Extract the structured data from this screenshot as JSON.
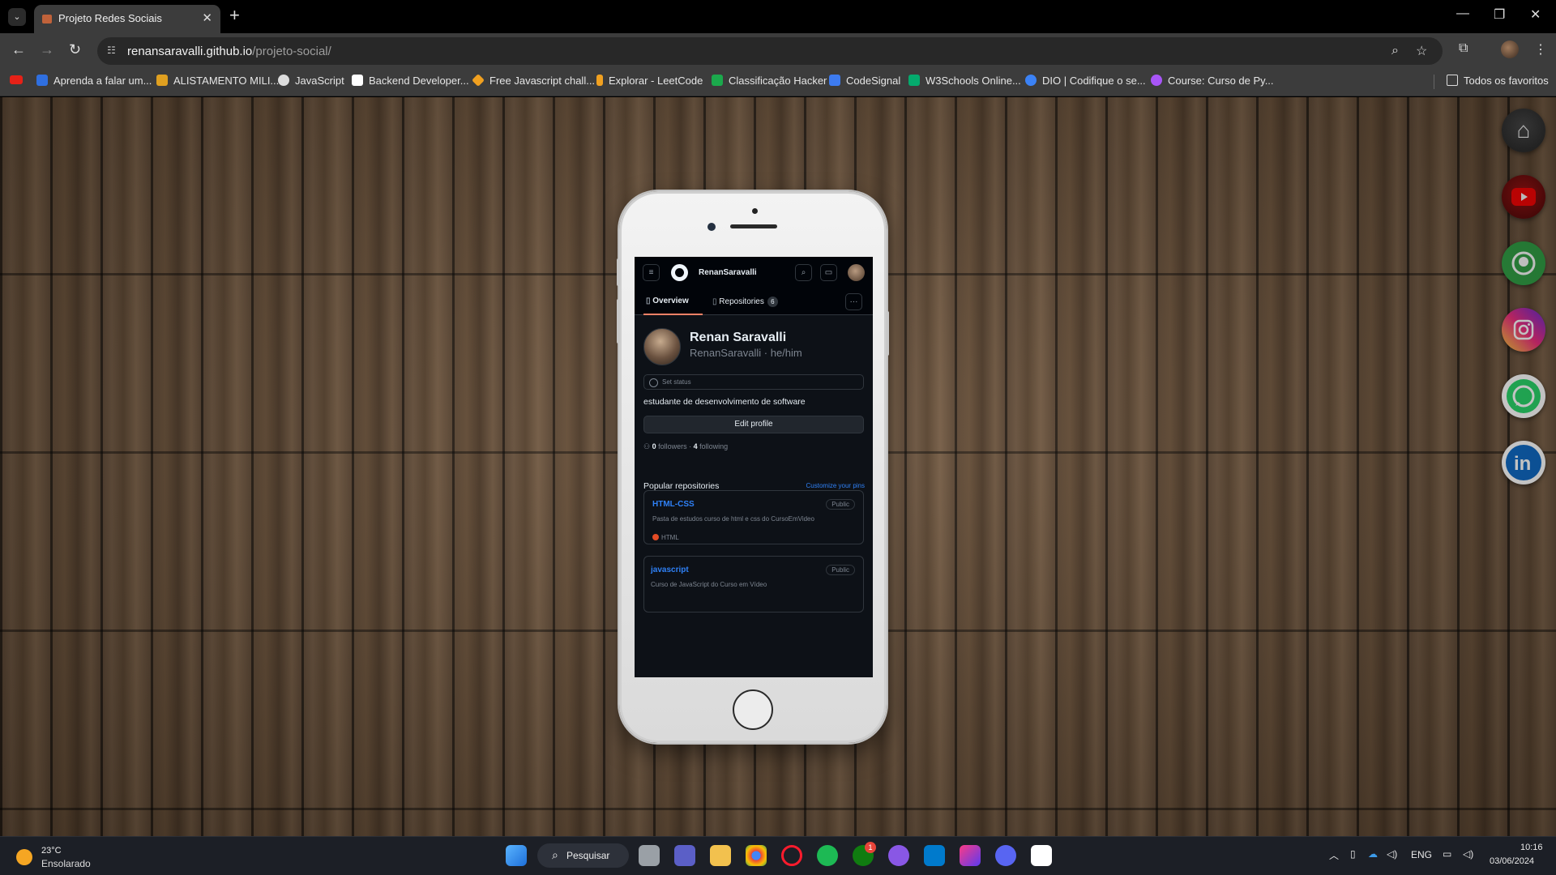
{
  "browser": {
    "tab_title": "Projeto Redes Sociais",
    "url_host": "renansaravalli.github.io",
    "url_path": "/projeto-social/",
    "bookmarks": [
      {
        "label": "Aprenda a falar um...",
        "color": "#2f6fe0"
      },
      {
        "label": "ALISTAMENTO MILI...",
        "color": "#e0a020"
      },
      {
        "label": "JavaScript",
        "color": "#dddddd"
      },
      {
        "label": "Backend Developer...",
        "color": "#ffffff"
      },
      {
        "label": "Free Javascript chall...",
        "color": "#f0a020"
      },
      {
        "label": "Explorar - LeetCode",
        "color": "#f0a020"
      },
      {
        "label": "Classificação Hacker",
        "color": "#1ba94c"
      },
      {
        "label": "CodeSignal",
        "color": "#3d7bf0"
      },
      {
        "label": "W3Schools Online...",
        "color": "#04aa6d"
      },
      {
        "label": "DIO | Codifique o se...",
        "color": "#3b82f6"
      },
      {
        "label": "Course: Curso de Py...",
        "color": "#a855f7"
      }
    ],
    "all_bookmarks": "Todos os favoritos"
  },
  "phone": {
    "username": "RenanSaravalli",
    "tabs": [
      {
        "label": "Overview"
      },
      {
        "label": "Repositories",
        "count": "6"
      }
    ],
    "profile": {
      "name": "Renan Saravalli",
      "handle": "RenanSaravalli · he/him",
      "status_placeholder": "Set status",
      "bio": "estudante de desenvolvimento de software",
      "edit_label": "Edit profile",
      "followers": "0",
      "followers_label": "followers",
      "following": "4",
      "following_label": "following"
    },
    "popular": {
      "title": "Popular repositories",
      "customize": "Customize your pins",
      "repos": [
        {
          "name": "HTML-CSS",
          "visibility": "Public",
          "description": "Pasta de estudos curso de html e css do CursoEmVideo",
          "language": "HTML"
        },
        {
          "name": "javascript",
          "visibility": "Public",
          "description": "Curso de JavaScript do Curso em Vídeo",
          "language": ""
        }
      ]
    }
  },
  "social_links": [
    {
      "name": "home",
      "color": "#3a3a3a"
    },
    {
      "name": "youtube",
      "color": "#7a0c0c"
    },
    {
      "name": "github",
      "color": "#2ea043"
    },
    {
      "name": "instagram",
      "color": "#d62976"
    },
    {
      "name": "whatsapp",
      "color": "#25d366"
    },
    {
      "name": "linkedin",
      "color": "#0a66c2"
    }
  ],
  "taskbar": {
    "weather_temp": "23°C",
    "weather_desc": "Ensolarado",
    "search_label": "Pesquisar",
    "language": "ENG",
    "time": "10:16",
    "date": "03/06/2024",
    "xbox_badge": "1"
  }
}
